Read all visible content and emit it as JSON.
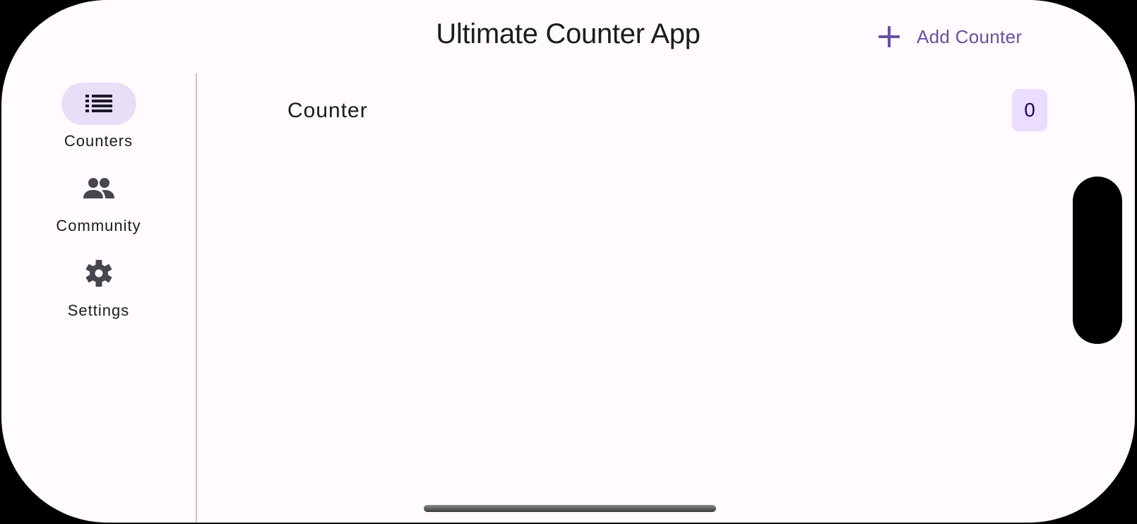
{
  "app_bar": {
    "title": "Ultimate Counter App",
    "add_action": {
      "icon": "plus-icon",
      "label": "Add Counter"
    }
  },
  "nav_rail": {
    "items": [
      {
        "label": "Counters",
        "icon": "list-icon",
        "selected": true
      },
      {
        "label": "Community",
        "icon": "people-icon",
        "selected": false
      },
      {
        "label": "Settings",
        "icon": "gear-icon",
        "selected": false
      }
    ]
  },
  "counters": [
    {
      "name": "Counter",
      "value": "0"
    }
  ],
  "colors": {
    "background": "#fffbfe",
    "primary": "#6750a4",
    "nav_indicator": "#e8def8",
    "badge_background": "#eaddff",
    "badge_text": "#21005d",
    "icon": "#49454f",
    "text": "#1c1b1f",
    "divider": "#cac4d0"
  }
}
